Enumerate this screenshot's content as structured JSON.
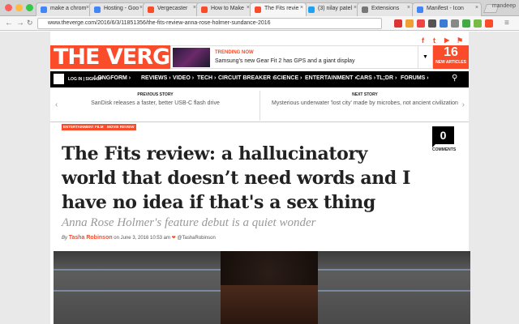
{
  "browser": {
    "tabs": [
      {
        "label": "make a chrom",
        "icon": "google-icon",
        "color": "#4285f4"
      },
      {
        "label": "Hosting - Goo",
        "icon": "google-icon",
        "color": "#4285f4"
      },
      {
        "label": "Vergecaster",
        "icon": "verge-icon",
        "color": "#fa4b2a"
      },
      {
        "label": "How to Make",
        "icon": "verge-icon",
        "color": "#fa4b2a"
      },
      {
        "label": "The Fits revie",
        "icon": "verge-icon",
        "color": "#fa4b2a",
        "active": true
      },
      {
        "label": "(3) nilay patel",
        "icon": "twitter-icon",
        "color": "#1da1f2"
      },
      {
        "label": "Extensions",
        "icon": "puzzle-icon",
        "color": "#777777"
      },
      {
        "label": "Manifest - Icon",
        "icon": "chrome-icon",
        "color": "#4285f4"
      }
    ],
    "profile": "mandeep",
    "url": "www.theverge.com/2016/6/3/11851356/the-fits-review-anna-rose-holmer-sundance-2016"
  },
  "header": {
    "social": [
      "f",
      "t",
      "▶",
      "⚑"
    ],
    "logo": "THE VERGE",
    "trending_label": "TRENDING NOW",
    "trending_text": "Samsung's new Gear Fit 2 has GPS and a giant display",
    "new_count": "16",
    "new_label": "NEW ARTICLES"
  },
  "nav": {
    "login": "LOG IN | SIGN UP",
    "items": [
      "LONGFORM ›",
      "REVIEWS ›",
      "VIDEO ›",
      "TECH ›",
      "CIRCUIT BREAKER ›",
      "SCIENCE ›",
      "ENTERTAINMENT ›",
      "CARS ›",
      "TL;DR ›",
      "FORUMS ›"
    ]
  },
  "stories": {
    "prev_label": "PREVIOUS STORY",
    "prev_title": "SanDisk releases a faster, better USB-C flash drive",
    "next_label": "NEXT STORY",
    "next_title": "Mysterious underwater 'lost city' made by microbes, not ancient civilization"
  },
  "article": {
    "tags": [
      "ENTERTAINMENT",
      "FILM",
      "MOVIE REVIEW"
    ],
    "comment_count": "0",
    "comments_label": "COMMENTS",
    "headline": "The Fits review: a hallucinatory world that doesn’t need words and I have no idea if that's a sex thing",
    "subhead": "Anna Rose Holmer's feature debut is a quiet wonder",
    "by": "By",
    "author": "Tasha Robinson",
    "date": "on June 3, 2016 10:53 am",
    "twitter": "@TashaRobinson"
  }
}
